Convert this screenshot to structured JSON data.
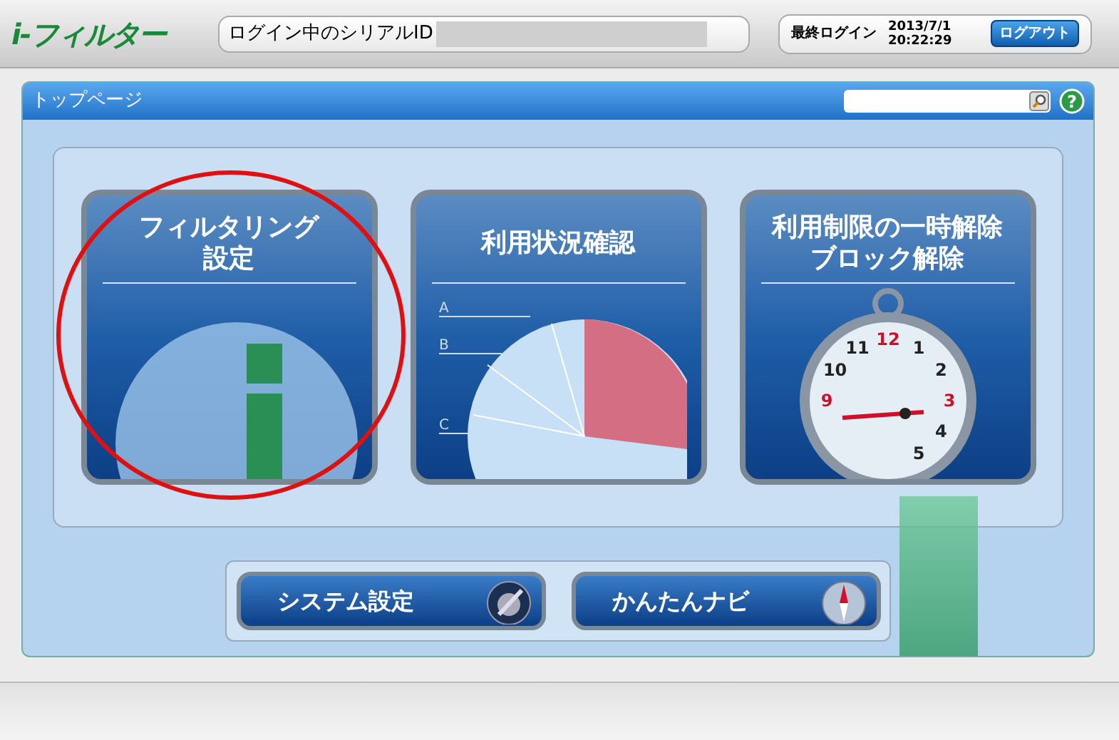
{
  "header": {
    "logo": "i-フィルター",
    "serial_label": "ログイン中のシリアルID",
    "last_login_label": "最終ログイン",
    "last_login_date": "2013/7/1",
    "last_login_time": "20:22:29",
    "logout_button": "ログアウト"
  },
  "panel": {
    "title": "トップページ",
    "help": "?"
  },
  "tiles": [
    {
      "kind": "filter",
      "title_lines": [
        "フィルタリング",
        "設定"
      ]
    },
    {
      "kind": "usage",
      "title_lines": [
        "利用状況確認"
      ],
      "pie_labels": [
        "A",
        "B",
        "C"
      ]
    },
    {
      "kind": "timer",
      "title_lines": [
        "利用制限の一時解除",
        "ブロック解除"
      ],
      "clock_numbers": [
        "12",
        "1",
        "2",
        "3",
        "4",
        "5",
        "9",
        "10",
        "11"
      ]
    }
  ],
  "buttons": [
    {
      "kind": "system",
      "label": "システム設定"
    },
    {
      "kind": "navi",
      "label": "かんたんナビ"
    }
  ]
}
